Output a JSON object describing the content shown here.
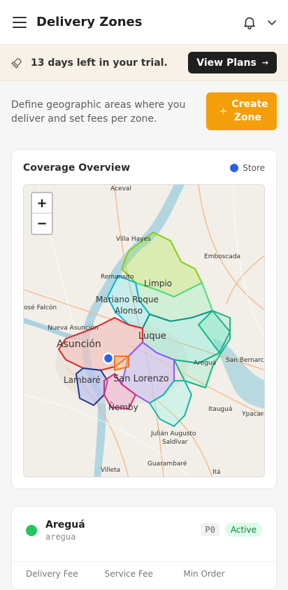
{
  "header": {
    "title": "Delivery Zones"
  },
  "trial": {
    "text": "13 days left in your trial.",
    "button_label": "View Plans",
    "button_arrow": "→"
  },
  "intro": {
    "description": "Define geographic areas where you deliver and set fees per zone.",
    "create_plus": "+",
    "create_label": "Create Zone"
  },
  "coverage": {
    "title": "Coverage Overview",
    "legend_label": "Store",
    "legend_color": "#2563eb",
    "zoom_in": "+",
    "zoom_out": "−",
    "map_labels": [
      "Aceval",
      "Villa Hayes",
      "Emboscada",
      "Remansito",
      "Limpio",
      "Mariano Roque",
      "Alonso",
      "osé Falcón",
      "Nueva Asunción",
      "Luque",
      "Asunción",
      "Areguá",
      "San Bernarc",
      "Lambaré",
      "San Lorenzo",
      "Ñemby",
      "Itauguá",
      "Ypacar",
      "Julián Augusto",
      "Saldívar",
      "Villeta",
      "Guarambaré",
      "Itá"
    ]
  },
  "zone": {
    "name": "Areguá",
    "slug": "aregua",
    "priority": "P0",
    "status": "Active",
    "status_color": "#22c55e",
    "columns": [
      "Delivery Fee",
      "Service Fee",
      "Min Order"
    ]
  }
}
